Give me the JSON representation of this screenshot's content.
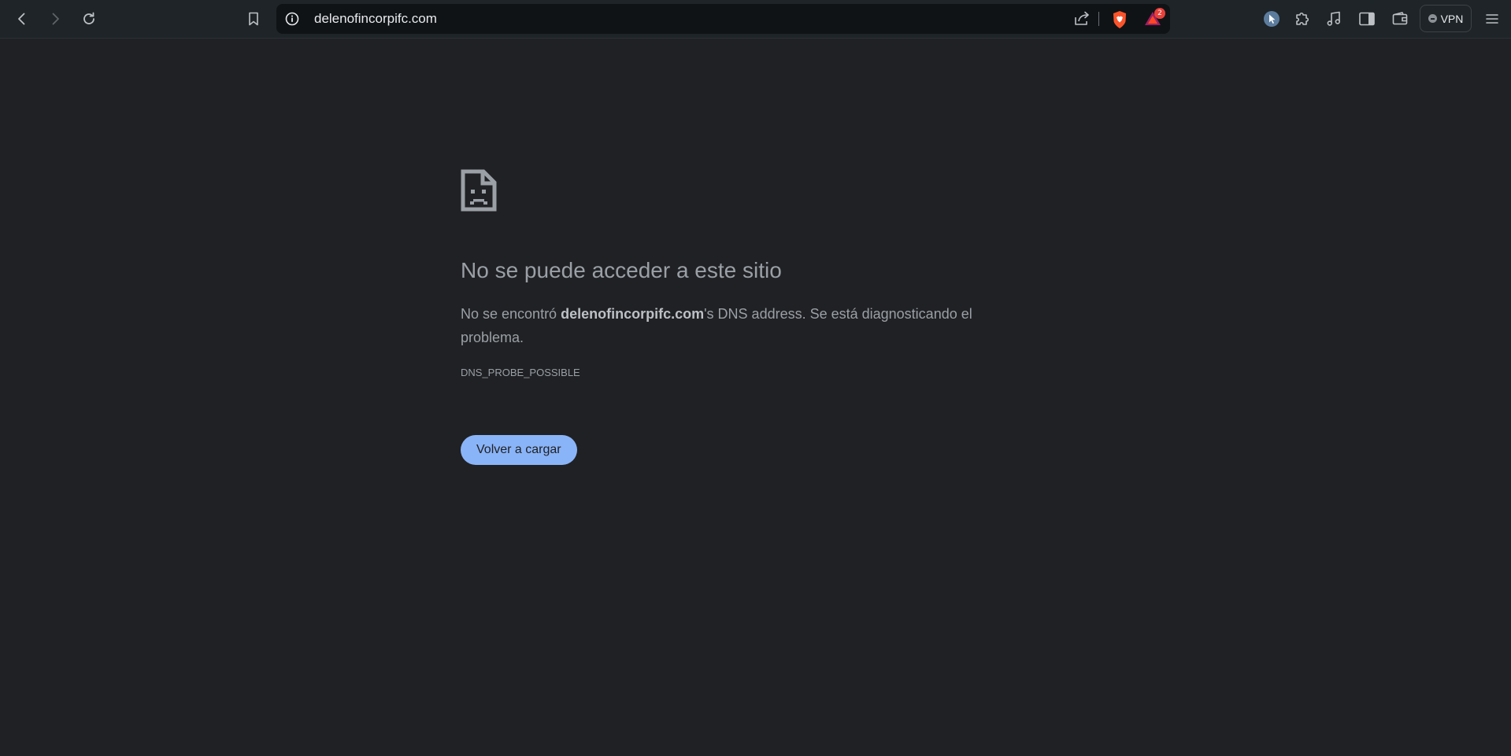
{
  "toolbar": {
    "back_icon": "chevron-left-icon",
    "forward_icon": "chevron-right-icon",
    "reload_icon": "reload-icon",
    "bookmark_icon": "bookmark-icon",
    "address": {
      "info_icon": "info-icon",
      "url": "delenofincorpifc.com",
      "share_icon": "share-icon",
      "shield_icon": "brave-shield-icon",
      "rewards_icon": "brave-rewards-icon",
      "rewards_badge": "2"
    },
    "extensions": [
      {
        "icon": "cursor-extension-icon"
      },
      {
        "icon": "puzzle-icon"
      },
      {
        "icon": "music-note-icon"
      },
      {
        "icon": "sidebar-icon"
      },
      {
        "icon": "wallet-icon"
      }
    ],
    "vpn_label": "VPN",
    "menu_icon": "hamburger-menu-icon"
  },
  "error": {
    "icon": "sad-document-icon",
    "title": "No se puede acceder a este sitio",
    "desc_prefix": "No se encontró ",
    "desc_domain": "delenofincorpifc.com",
    "desc_suffix": "'s DNS address. Se está diagnosticando el problema.",
    "code": "DNS_PROBE_POSSIBLE",
    "reload_label": "Volver a cargar"
  },
  "colors": {
    "background": "#202124",
    "toolbar": "#1e2427",
    "urlbar": "#101316",
    "accent_button": "#8ab4f8",
    "text_muted": "#9aa0a6",
    "badge": "#e8413b",
    "brave_orange": "#fb542b"
  }
}
